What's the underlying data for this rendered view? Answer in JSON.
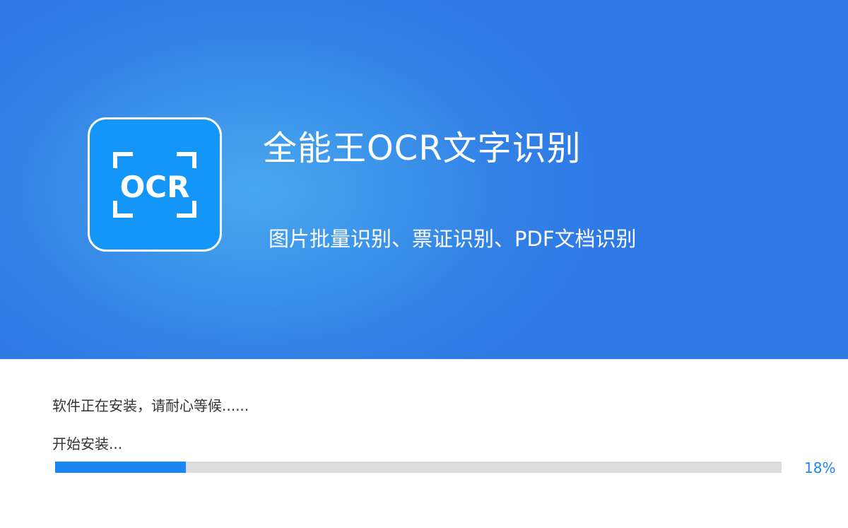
{
  "banner": {
    "logo_text": "OCR",
    "title": "全能王OCR文字识别",
    "subtitle": "图片批量识别、票证识别、PDF文档识别",
    "colors": {
      "banner_center": "#48a8ee",
      "banner_edge": "#2f79e5",
      "icon_background": "#1396f8"
    }
  },
  "install": {
    "status": "软件正在安装，请耐心等候......",
    "step": "开始安装...",
    "progress": 18,
    "progress_label": "18%",
    "colors": {
      "progress_fill": "#1a86f4",
      "progress_track": "#dcdcdc"
    }
  }
}
